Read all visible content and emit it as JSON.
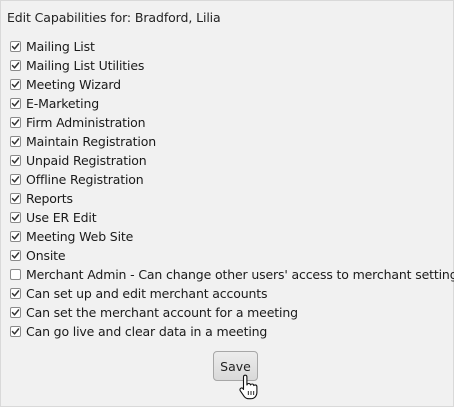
{
  "dialog": {
    "title": "Edit Capabilities for: Bradford, Lilia",
    "save_label": "Save"
  },
  "capabilities": [
    {
      "label": "Mailing List",
      "checked": true
    },
    {
      "label": "Mailing List Utilities",
      "checked": true
    },
    {
      "label": "Meeting Wizard",
      "checked": true
    },
    {
      "label": "E-Marketing",
      "checked": true
    },
    {
      "label": "Firm Administration",
      "checked": true
    },
    {
      "label": "Maintain Registration",
      "checked": true
    },
    {
      "label": "Unpaid Registration",
      "checked": true
    },
    {
      "label": "Offline Registration",
      "checked": true
    },
    {
      "label": "Reports",
      "checked": true
    },
    {
      "label": "Use ER Edit",
      "checked": true
    },
    {
      "label": "Meeting Web Site",
      "checked": true
    },
    {
      "label": "Onsite",
      "checked": true
    },
    {
      "label": "Merchant Admin - Can change other users' access to merchant settings",
      "checked": false
    },
    {
      "label": "Can set up and edit merchant accounts",
      "checked": true
    },
    {
      "label": "Can set the merchant account for a meeting",
      "checked": true
    },
    {
      "label": "Can go live and clear data in a meeting",
      "checked": true
    }
  ],
  "cursor": {
    "icon": "hand-pointer-icon"
  }
}
